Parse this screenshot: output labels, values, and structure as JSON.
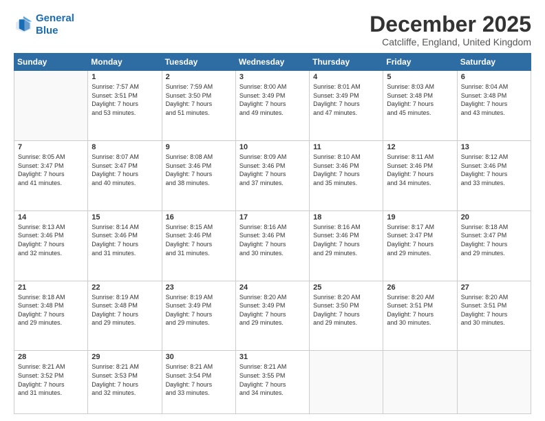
{
  "header": {
    "logo_line1": "General",
    "logo_line2": "Blue",
    "month_title": "December 2025",
    "location": "Catcliffe, England, United Kingdom"
  },
  "weekdays": [
    "Sunday",
    "Monday",
    "Tuesday",
    "Wednesday",
    "Thursday",
    "Friday",
    "Saturday"
  ],
  "weeks": [
    [
      {
        "day": "",
        "info": ""
      },
      {
        "day": "1",
        "info": "Sunrise: 7:57 AM\nSunset: 3:51 PM\nDaylight: 7 hours\nand 53 minutes."
      },
      {
        "day": "2",
        "info": "Sunrise: 7:59 AM\nSunset: 3:50 PM\nDaylight: 7 hours\nand 51 minutes."
      },
      {
        "day": "3",
        "info": "Sunrise: 8:00 AM\nSunset: 3:49 PM\nDaylight: 7 hours\nand 49 minutes."
      },
      {
        "day": "4",
        "info": "Sunrise: 8:01 AM\nSunset: 3:49 PM\nDaylight: 7 hours\nand 47 minutes."
      },
      {
        "day": "5",
        "info": "Sunrise: 8:03 AM\nSunset: 3:48 PM\nDaylight: 7 hours\nand 45 minutes."
      },
      {
        "day": "6",
        "info": "Sunrise: 8:04 AM\nSunset: 3:48 PM\nDaylight: 7 hours\nand 43 minutes."
      }
    ],
    [
      {
        "day": "7",
        "info": "Sunrise: 8:05 AM\nSunset: 3:47 PM\nDaylight: 7 hours\nand 41 minutes."
      },
      {
        "day": "8",
        "info": "Sunrise: 8:07 AM\nSunset: 3:47 PM\nDaylight: 7 hours\nand 40 minutes."
      },
      {
        "day": "9",
        "info": "Sunrise: 8:08 AM\nSunset: 3:46 PM\nDaylight: 7 hours\nand 38 minutes."
      },
      {
        "day": "10",
        "info": "Sunrise: 8:09 AM\nSunset: 3:46 PM\nDaylight: 7 hours\nand 37 minutes."
      },
      {
        "day": "11",
        "info": "Sunrise: 8:10 AM\nSunset: 3:46 PM\nDaylight: 7 hours\nand 35 minutes."
      },
      {
        "day": "12",
        "info": "Sunrise: 8:11 AM\nSunset: 3:46 PM\nDaylight: 7 hours\nand 34 minutes."
      },
      {
        "day": "13",
        "info": "Sunrise: 8:12 AM\nSunset: 3:46 PM\nDaylight: 7 hours\nand 33 minutes."
      }
    ],
    [
      {
        "day": "14",
        "info": "Sunrise: 8:13 AM\nSunset: 3:46 PM\nDaylight: 7 hours\nand 32 minutes."
      },
      {
        "day": "15",
        "info": "Sunrise: 8:14 AM\nSunset: 3:46 PM\nDaylight: 7 hours\nand 31 minutes."
      },
      {
        "day": "16",
        "info": "Sunrise: 8:15 AM\nSunset: 3:46 PM\nDaylight: 7 hours\nand 31 minutes."
      },
      {
        "day": "17",
        "info": "Sunrise: 8:16 AM\nSunset: 3:46 PM\nDaylight: 7 hours\nand 30 minutes."
      },
      {
        "day": "18",
        "info": "Sunrise: 8:16 AM\nSunset: 3:46 PM\nDaylight: 7 hours\nand 29 minutes."
      },
      {
        "day": "19",
        "info": "Sunrise: 8:17 AM\nSunset: 3:47 PM\nDaylight: 7 hours\nand 29 minutes."
      },
      {
        "day": "20",
        "info": "Sunrise: 8:18 AM\nSunset: 3:47 PM\nDaylight: 7 hours\nand 29 minutes."
      }
    ],
    [
      {
        "day": "21",
        "info": "Sunrise: 8:18 AM\nSunset: 3:48 PM\nDaylight: 7 hours\nand 29 minutes."
      },
      {
        "day": "22",
        "info": "Sunrise: 8:19 AM\nSunset: 3:48 PM\nDaylight: 7 hours\nand 29 minutes."
      },
      {
        "day": "23",
        "info": "Sunrise: 8:19 AM\nSunset: 3:49 PM\nDaylight: 7 hours\nand 29 minutes."
      },
      {
        "day": "24",
        "info": "Sunrise: 8:20 AM\nSunset: 3:49 PM\nDaylight: 7 hours\nand 29 minutes."
      },
      {
        "day": "25",
        "info": "Sunrise: 8:20 AM\nSunset: 3:50 PM\nDaylight: 7 hours\nand 29 minutes."
      },
      {
        "day": "26",
        "info": "Sunrise: 8:20 AM\nSunset: 3:51 PM\nDaylight: 7 hours\nand 30 minutes."
      },
      {
        "day": "27",
        "info": "Sunrise: 8:20 AM\nSunset: 3:51 PM\nDaylight: 7 hours\nand 30 minutes."
      }
    ],
    [
      {
        "day": "28",
        "info": "Sunrise: 8:21 AM\nSunset: 3:52 PM\nDaylight: 7 hours\nand 31 minutes."
      },
      {
        "day": "29",
        "info": "Sunrise: 8:21 AM\nSunset: 3:53 PM\nDaylight: 7 hours\nand 32 minutes."
      },
      {
        "day": "30",
        "info": "Sunrise: 8:21 AM\nSunset: 3:54 PM\nDaylight: 7 hours\nand 33 minutes."
      },
      {
        "day": "31",
        "info": "Sunrise: 8:21 AM\nSunset: 3:55 PM\nDaylight: 7 hours\nand 34 minutes."
      },
      {
        "day": "",
        "info": ""
      },
      {
        "day": "",
        "info": ""
      },
      {
        "day": "",
        "info": ""
      }
    ]
  ]
}
